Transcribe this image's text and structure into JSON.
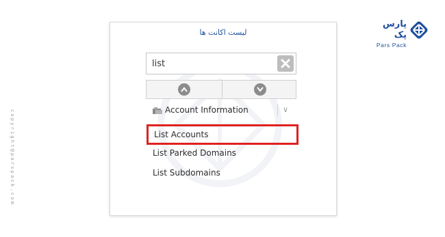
{
  "panel": {
    "title": "لیست اکانت ها"
  },
  "search": {
    "value": "list",
    "placeholder": ""
  },
  "section": {
    "label": "Account Information",
    "toggle_symbol": "∨"
  },
  "menu": {
    "items": [
      {
        "label": "List Accounts",
        "highlighted": true
      },
      {
        "label": "List Parked Domains",
        "highlighted": false
      },
      {
        "label": "List Subdomains",
        "highlighted": false
      }
    ]
  },
  "brand": {
    "name_fa": "پارس پک",
    "name_en": "Pars Pack"
  },
  "copyright": "copyright@parspack.com",
  "colors": {
    "brand_blue": "#1f4e9b",
    "highlight_red": "#e02020"
  }
}
